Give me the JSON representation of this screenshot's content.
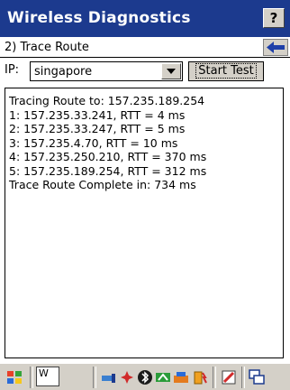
{
  "window": {
    "title": "Wireless Diagnostics",
    "help_label": "?"
  },
  "subheader": {
    "label": "2) Trace Route"
  },
  "ip_row": {
    "label": "IP:",
    "selected_value": "singapore",
    "start_button_label": "Start Test"
  },
  "output": {
    "lines": [
      "Tracing Route to: 157.235.189.254",
      "1: 157.235.33.241, RTT = 4 ms",
      "2: 157.235.33.247, RTT = 5 ms",
      "3: 157.235.4.70, RTT = 10 ms",
      "4: 157.235.250.210, RTT = 370 ms",
      "5: 157.235.189.254, RTT = 312 ms",
      "Trace Route Complete in: 734 ms"
    ]
  },
  "taskbar": {
    "input_text": "W",
    "icons": [
      "start-icon",
      "network-icon",
      "bluetooth-icon",
      "wifi-icon",
      "battery-icon",
      "edit-icon",
      "windows-icon"
    ]
  },
  "colors": {
    "titlebar": "#1c3a8e",
    "back_arrow": "#1e3fa8"
  }
}
